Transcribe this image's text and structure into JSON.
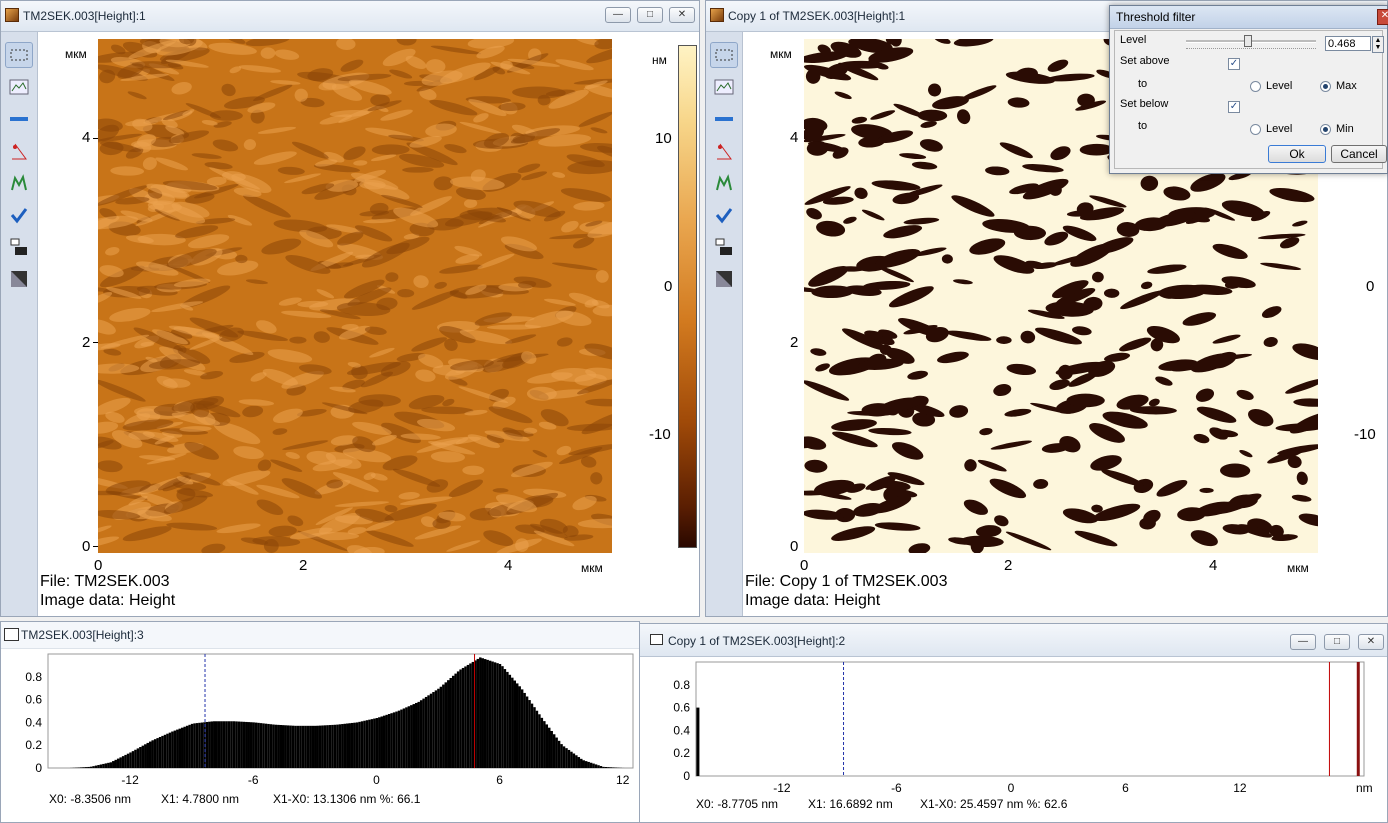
{
  "win1": {
    "title": "TM2SEK.003[Height]:1",
    "y_unit": "мкм",
    "x_unit": "мкм",
    "cb_unit": "нм",
    "y_ticks": [
      "4",
      "2",
      "0"
    ],
    "x_ticks": [
      "0",
      "2",
      "4"
    ],
    "cb_ticks": [
      "10",
      "0",
      "-10"
    ],
    "file": "File: TM2SEK.003",
    "image_data": "Image data: Height"
  },
  "win2": {
    "title": "Copy 1 of TM2SEK.003[Height]:1",
    "y_unit": "мкм",
    "x_unit": "мкм",
    "y_ticks": [
      "4",
      "2",
      "0"
    ],
    "x_ticks": [
      "0",
      "2",
      "4"
    ],
    "cb_ticks": [
      "0",
      "-10"
    ],
    "file": "File: Copy 1 of TM2SEK.003",
    "image_data": "Image data: Height"
  },
  "dialog": {
    "title": "Threshold filter",
    "level_label": "Level",
    "level_value": "0.468",
    "set_above_label": "Set above",
    "set_below_label": "Set below",
    "to_label": "to",
    "opt_level": "Level",
    "opt_max": "Max",
    "opt_min": "Min",
    "ok": "Ok",
    "cancel": "Cancel"
  },
  "hist1": {
    "title": "TM2SEK.003[Height]:3",
    "y_ticks": [
      "0.8",
      "0.6",
      "0.4",
      "0.2",
      "0"
    ],
    "x_ticks": [
      "-12",
      "-6",
      "0",
      "6",
      "12"
    ],
    "x0": "X0: -8.3506 nm",
    "x1": "X1: 4.7800 nm",
    "diff": "X1-X0: 13.1306 nm %: 66.1"
  },
  "hist2": {
    "title": "Copy 1 of TM2SEK.003[Height]:2",
    "y_ticks": [
      "0.8",
      "0.6",
      "0.4",
      "0.2",
      "0"
    ],
    "x_ticks": [
      "-12",
      "-6",
      "0",
      "6",
      "12"
    ],
    "x_unit": "nm",
    "x0": "X0: -8.7705 nm",
    "x1": "X1: 16.6892 nm",
    "diff": "X1-X0: 25.4597 nm %: 62.6"
  },
  "chart_data": [
    {
      "type": "bar",
      "title": "TM2SEK.003[Height]:3",
      "xlim": [
        -16,
        12.5
      ],
      "ylim": [
        0,
        1
      ],
      "x": [
        -16,
        -15,
        -14,
        -13,
        -12,
        -11,
        -10,
        -9,
        -8,
        -7,
        -6,
        -5,
        -4,
        -3,
        -2,
        -1,
        0,
        1,
        2,
        3,
        4,
        5,
        6,
        7,
        8,
        9,
        10,
        11,
        12
      ],
      "values": [
        0,
        0,
        0.01,
        0.05,
        0.14,
        0.24,
        0.32,
        0.39,
        0.41,
        0.41,
        0.4,
        0.38,
        0.37,
        0.37,
        0.38,
        0.4,
        0.44,
        0.5,
        0.58,
        0.7,
        0.86,
        0.97,
        0.91,
        0.7,
        0.44,
        0.2,
        0.07,
        0.01,
        0
      ],
      "cursors": {
        "x0": -8.3506,
        "x1": 4.78
      }
    },
    {
      "type": "bar",
      "title": "Copy 1 of TM2SEK.003[Height]:2",
      "xlim": [
        -16.5,
        18.5
      ],
      "ylim": [
        0,
        1
      ],
      "x": [
        -16.4,
        18.2
      ],
      "values": [
        0.6,
        1.0
      ],
      "cursors": {
        "x0": -8.7705,
        "x1": 16.6892
      }
    }
  ]
}
